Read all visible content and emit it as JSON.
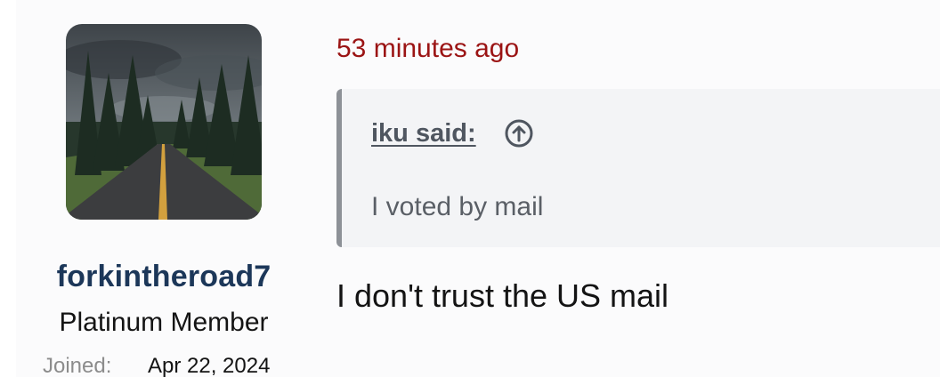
{
  "user": {
    "username": "forkintheroad7",
    "title": "Platinum Member",
    "joined_label": "Joined:",
    "joined_value": "Apr 22, 2024",
    "avatar_icon": "forest-road-avatar"
  },
  "post": {
    "timestamp": "53 minutes ago",
    "quote": {
      "author": "iku said:",
      "jump_icon": "arrow-up-circle-icon",
      "text": "I voted by mail"
    },
    "message": "I don't trust the US mail"
  },
  "colors": {
    "username": "#1c3759",
    "timestamp": "#9b1414",
    "quote_bg": "#f3f4f6",
    "quote_border": "#8d9197"
  }
}
